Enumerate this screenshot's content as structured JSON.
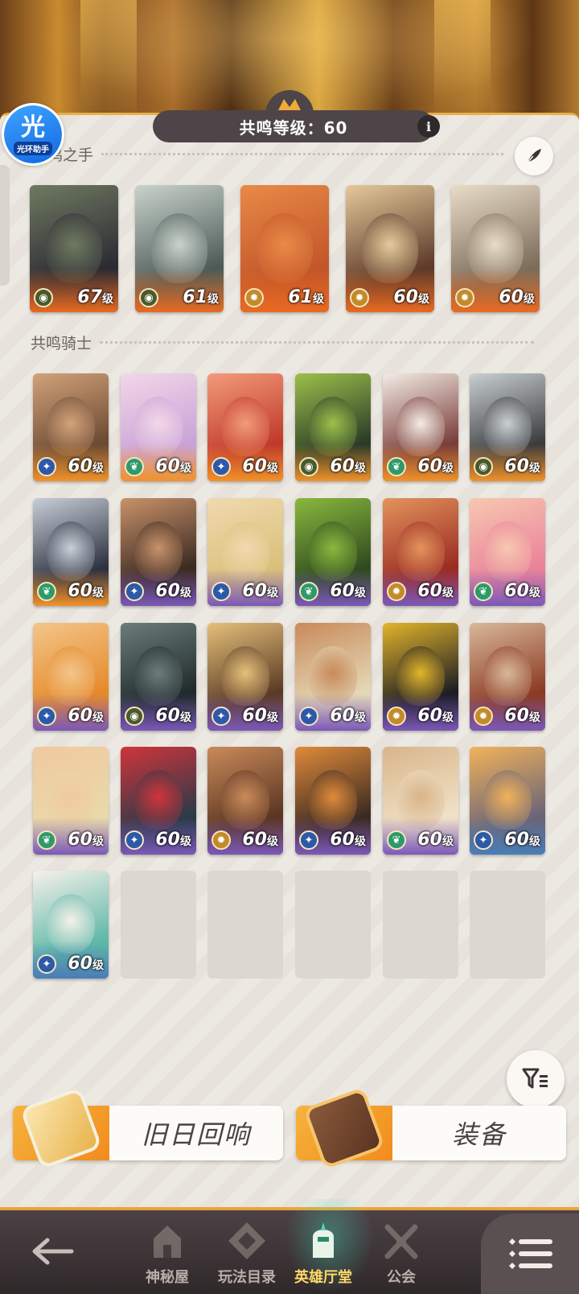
{
  "header": {
    "level_label": "共鸣等级：60",
    "info_glyph": "i",
    "helper_badge": {
      "big": "光",
      "small": "光环助手"
    }
  },
  "sections": {
    "hands_title": "共鸣之手",
    "knights_title": "共鸣骑士"
  },
  "hands": [
    {
      "level": "67",
      "unit": "级",
      "faction": "wilder",
      "palette": [
        "#2b2a33",
        "#6f7a60"
      ]
    },
    {
      "level": "61",
      "unit": "级",
      "faction": "wilder",
      "palette": [
        "#4d5b57",
        "#c9d3cc"
      ]
    },
    {
      "level": "61",
      "unit": "级",
      "faction": "lightbearer",
      "palette": [
        "#c2552a",
        "#e88a47"
      ]
    },
    {
      "level": "60",
      "unit": "级",
      "faction": "lightbearer",
      "palette": [
        "#5d3a2a",
        "#e5c99a"
      ]
    },
    {
      "level": "60",
      "unit": "级",
      "faction": "lightbearer",
      "palette": [
        "#7c6c5a",
        "#e9ddc8"
      ]
    }
  ],
  "knights": [
    {
      "level": "60",
      "unit": "级",
      "faction": "star",
      "tier": "orange",
      "palette": [
        "#6b4a33",
        "#d2a27a"
      ]
    },
    {
      "level": "60",
      "unit": "级",
      "faction": "leaf",
      "tier": "orange",
      "palette": [
        "#c9a3d8",
        "#f2d7e8"
      ]
    },
    {
      "level": "60",
      "unit": "级",
      "faction": "star",
      "tier": "orange",
      "palette": [
        "#c0392b",
        "#f29b7a"
      ]
    },
    {
      "level": "60",
      "unit": "级",
      "faction": "wilder",
      "tier": "orange",
      "palette": [
        "#2a3a28",
        "#9cc04a"
      ]
    },
    {
      "level": "60",
      "unit": "级",
      "faction": "leaf",
      "tier": "orange",
      "palette": [
        "#7a3d3a",
        "#f3ece5"
      ]
    },
    {
      "level": "60",
      "unit": "级",
      "faction": "wilder",
      "tier": "orange",
      "palette": [
        "#3b3c3e",
        "#c9cfd2"
      ]
    },
    {
      "level": "60",
      "unit": "级",
      "faction": "leaf",
      "tier": "orange",
      "palette": [
        "#2d3140",
        "#c8cfd8"
      ]
    },
    {
      "level": "60",
      "unit": "级",
      "faction": "star",
      "tier": "purple",
      "palette": [
        "#3b2a22",
        "#c9926a"
      ]
    },
    {
      "level": "60",
      "unit": "级",
      "faction": "star",
      "tier": "purple",
      "palette": [
        "#d9c07a",
        "#f1d9b0"
      ]
    },
    {
      "level": "60",
      "unit": "级",
      "faction": "leaf",
      "tier": "purple",
      "palette": [
        "#2f4a1e",
        "#8ab83e"
      ]
    },
    {
      "level": "60",
      "unit": "级",
      "faction": "lightbearer",
      "tier": "purple",
      "palette": [
        "#9a2b22",
        "#e3935d"
      ]
    },
    {
      "level": "60",
      "unit": "级",
      "faction": "leaf",
      "tier": "purple",
      "palette": [
        "#e9829a",
        "#f8c7b0"
      ]
    },
    {
      "level": "60",
      "unit": "级",
      "faction": "star",
      "tier": "purple",
      "palette": [
        "#e58a2a",
        "#f3c58a"
      ]
    },
    {
      "level": "60",
      "unit": "级",
      "faction": "wilder",
      "tier": "purple",
      "palette": [
        "#1f2a2a",
        "#6b7d7a"
      ]
    },
    {
      "level": "60",
      "unit": "级",
      "faction": "star",
      "tier": "purple",
      "palette": [
        "#5a3a25",
        "#e5c07a"
      ]
    },
    {
      "level": "60",
      "unit": "级",
      "faction": "star",
      "tier": "purple",
      "palette": [
        "#e4d9b8",
        "#c98a5a"
      ]
    },
    {
      "level": "60",
      "unit": "级",
      "faction": "lightbearer",
      "tier": "purple",
      "palette": [
        "#1c1c24",
        "#e2b52a"
      ]
    },
    {
      "level": "60",
      "unit": "级",
      "faction": "lightbearer",
      "tier": "purple",
      "palette": [
        "#8a3a22",
        "#d9b89a"
      ]
    },
    {
      "level": "60",
      "unit": "级",
      "faction": "leaf",
      "tier": "purple",
      "palette": [
        "#e9d9a8",
        "#f0c9a0"
      ]
    },
    {
      "level": "60",
      "unit": "级",
      "faction": "star",
      "tier": "purple",
      "palette": [
        "#2a3a48",
        "#d0343a"
      ]
    },
    {
      "level": "60",
      "unit": "级",
      "faction": "lightbearer",
      "tier": "purple",
      "palette": [
        "#5a3522",
        "#c98a5a"
      ]
    },
    {
      "level": "60",
      "unit": "级",
      "faction": "star",
      "tier": "purple",
      "palette": [
        "#3a2a22",
        "#e08a3a"
      ]
    },
    {
      "level": "60",
      "unit": "级",
      "faction": "leaf",
      "tier": "purple",
      "palette": [
        "#f0e2c8",
        "#d9b58a"
      ]
    },
    {
      "level": "60",
      "unit": "级",
      "faction": "star",
      "tier": "blue",
      "palette": [
        "#6a6478",
        "#f2b25a"
      ]
    },
    {
      "level": "60",
      "unit": "级",
      "faction": "star",
      "tier": "blue",
      "palette": [
        "#5fb8a8",
        "#f6f1ea"
      ]
    }
  ],
  "empty_slots": 5,
  "buttons": {
    "echoes": "旧日回响",
    "equipment": "装备"
  },
  "nav": {
    "items": [
      {
        "label": "神秘屋",
        "icon": "mystery-house-icon"
      },
      {
        "label": "玩法目录",
        "icon": "modes-icon"
      },
      {
        "label": "英雄厅堂",
        "icon": "hero-hall-icon",
        "active": true
      },
      {
        "label": "公会",
        "icon": "guild-icon"
      }
    ]
  },
  "factions": {
    "wilder": "#4b5a2a",
    "lightbearer": "#c48a2a",
    "star": "#2d5aa8",
    "leaf": "#2e9a6a"
  },
  "tiers": {
    "orange": "#f0922a",
    "purple": "#7b58b8",
    "blue": "#4a7db8"
  }
}
